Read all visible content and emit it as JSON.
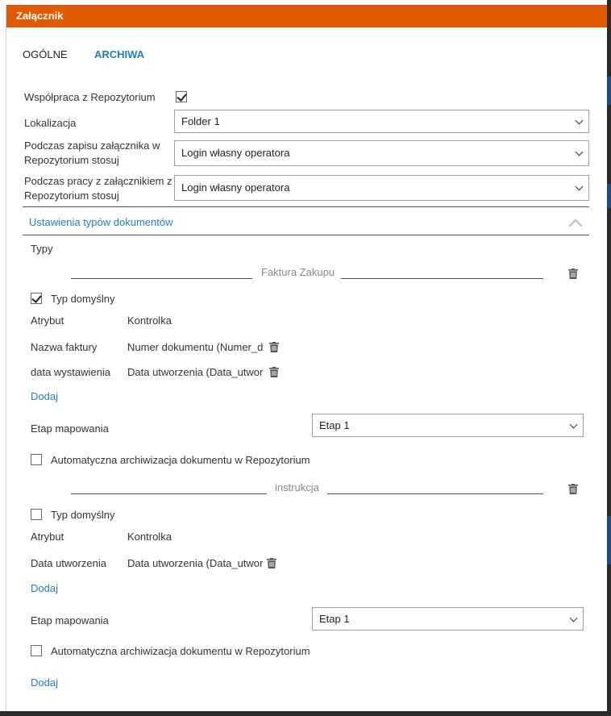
{
  "dialog": {
    "title": "Załącznik"
  },
  "tabs": [
    {
      "label": "OGÓLNE"
    },
    {
      "label": "ARCHIWA"
    }
  ],
  "settings": {
    "repo_cooperation_label": "Współpraca z Repozytorium",
    "repo_cooperation_checked": true,
    "location_label": "Lokalizacja",
    "location_value": "Folder 1",
    "save_label": "Podczas zapisu załącznika w Repozytorium stosuj",
    "save_value": "Login własny operatora",
    "work_label": "Podczas pracy z załącznikiem z Repozytorium stosuj",
    "work_value": "Login własny operatora"
  },
  "doc_types": {
    "header": "Ustawienia typów dokumentów",
    "types_label": "Typy",
    "blocks": [
      {
        "name": "Faktura Zakupu",
        "default_label": "Typ domyślny",
        "default_checked": true,
        "col_attribute": "Atrybut",
        "col_control": "Kontrolka",
        "rows": [
          {
            "attribute": "Nazwa faktury",
            "control": "Numer dokumentu (Numer_d"
          },
          {
            "attribute": "data wystawienia",
            "control": "Data utworzenia (Data_utwor"
          }
        ],
        "add_label": "Dodaj",
        "stage_label": "Etap mapowania",
        "stage_value": "Etap 1",
        "auto_archive_label": "Automatyczna archiwizacja dokumentu w Repozytorium",
        "auto_archive_checked": false
      },
      {
        "name": "instrukcja",
        "default_label": "Typ domyślny",
        "default_checked": false,
        "col_attribute": "Atrybut",
        "col_control": "Kontrolka",
        "rows": [
          {
            "attribute": "Data utworzenia",
            "control": "Data utworzenia (Data_utwor"
          }
        ],
        "add_label": "Dodaj",
        "stage_label": "Etap mapowania",
        "stage_value": "Etap 1",
        "auto_archive_label": "Automatyczna archiwizacja dokumentu w Repozytorium",
        "auto_archive_checked": false
      }
    ],
    "add_type_label": "Dodaj"
  },
  "icons": {
    "trash": "trash-icon",
    "chevron_down": "chevron-down-icon",
    "collapse": "chevron-up-icon"
  },
  "colors": {
    "title_bar": "#e05a00",
    "link": "#1e7fc2"
  }
}
